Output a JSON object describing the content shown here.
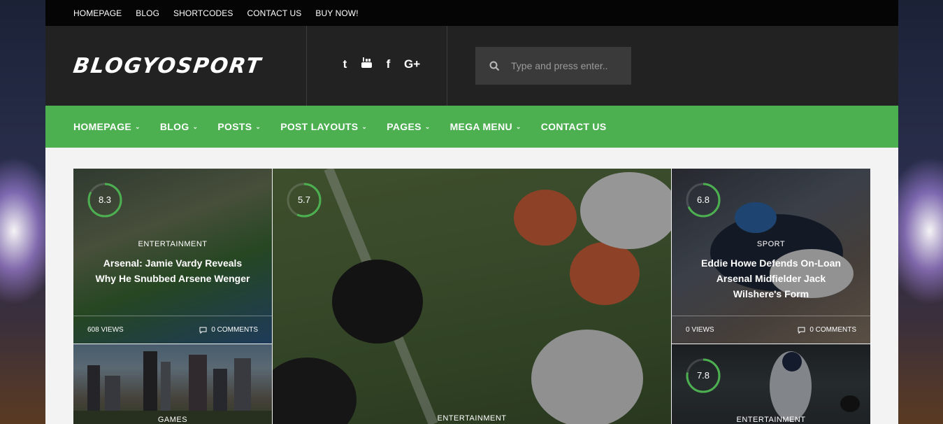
{
  "topbar": {
    "items": [
      "HOMEPAGE",
      "BLOG",
      "SHORTCODES",
      "CONTACT US",
      "BUY NOW!"
    ]
  },
  "header": {
    "logo": "BLOGYOSPORT",
    "social": [
      {
        "icon": "twitter-icon",
        "glyph": "t"
      },
      {
        "icon": "youtube-icon",
        "glyph": "▶"
      },
      {
        "icon": "facebook-icon",
        "glyph": "f"
      },
      {
        "icon": "google-plus-icon",
        "glyph": "G+"
      }
    ],
    "search_placeholder": "Type and press enter.."
  },
  "mainnav": {
    "items": [
      {
        "label": "HOMEPAGE",
        "chevron": true
      },
      {
        "label": "BLOG",
        "chevron": true
      },
      {
        "label": "POSTS",
        "chevron": true
      },
      {
        "label": "POST LAYOUTS",
        "chevron": true
      },
      {
        "label": "PAGES",
        "chevron": true
      },
      {
        "label": "MEGA MENU",
        "chevron": true
      },
      {
        "label": "CONTACT US",
        "chevron": false
      }
    ]
  },
  "colors": {
    "accent": "#4caf50",
    "topbar": "#050505",
    "header": "#222222"
  },
  "posts": [
    {
      "score": "8.3",
      "score_value": 8.3,
      "category": "ENTERTAINMENT",
      "title": "Arsenal: Jamie Vardy Reveals Why He Snubbed Arsene Wenger",
      "views": "608 VIEWS",
      "comments": "0 COMMENTS",
      "image": "football-player-photo"
    },
    {
      "score": "5.7",
      "score_value": 5.7,
      "category": "ENTERTAINMENT",
      "image": "football-linemen-photo"
    },
    {
      "score": "6.8",
      "score_value": 6.8,
      "category": "SPORT",
      "title": "Eddie Howe Defends On-Loan Arsenal Midfielder Jack Wilshere's Form",
      "views": "0 VIEWS",
      "comments": "0 COMMENTS",
      "image": "motorbike-racer-photo"
    },
    {
      "category": "GAMES",
      "image": "city-skyline-photo"
    },
    {
      "score": "7.8",
      "score_value": 7.8,
      "category": "ENTERTAINMENT",
      "image": "baseball-pitcher-photo"
    }
  ]
}
